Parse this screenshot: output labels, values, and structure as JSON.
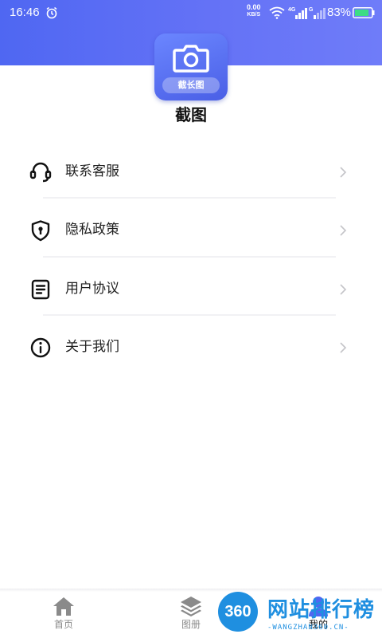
{
  "status_bar": {
    "time": "16:46",
    "net_speed_value": "0.00",
    "net_speed_unit": "KB/S",
    "battery_percent": "83%",
    "icons": [
      "alarm-icon",
      "wifi-icon",
      "signal-4g-icon",
      "signal-icon",
      "battery-icon"
    ]
  },
  "header": {
    "gradient_colors": [
      "#4f67f2",
      "#6f7cf9"
    ],
    "logo_badge": "截长图",
    "app_name": "截图"
  },
  "menu": {
    "items": [
      {
        "label": "联系客服",
        "icon": "headset-icon"
      },
      {
        "label": "隐私政策",
        "icon": "shield-lock-icon"
      },
      {
        "label": "用户协议",
        "icon": "document-icon"
      },
      {
        "label": "关于我们",
        "icon": "info-icon"
      }
    ]
  },
  "bottom_nav": {
    "tabs": [
      {
        "label": "首页",
        "icon": "home-icon",
        "active": false
      },
      {
        "label": "图册",
        "icon": "layers-icon",
        "active": false
      },
      {
        "label": "我的",
        "icon": "user-icon",
        "active": true
      }
    ]
  },
  "watermark": {
    "logo": "360",
    "title": "网站排行榜",
    "subtitle": "-WANGZHAN360.CN-",
    "color": "#1f8fe0"
  }
}
